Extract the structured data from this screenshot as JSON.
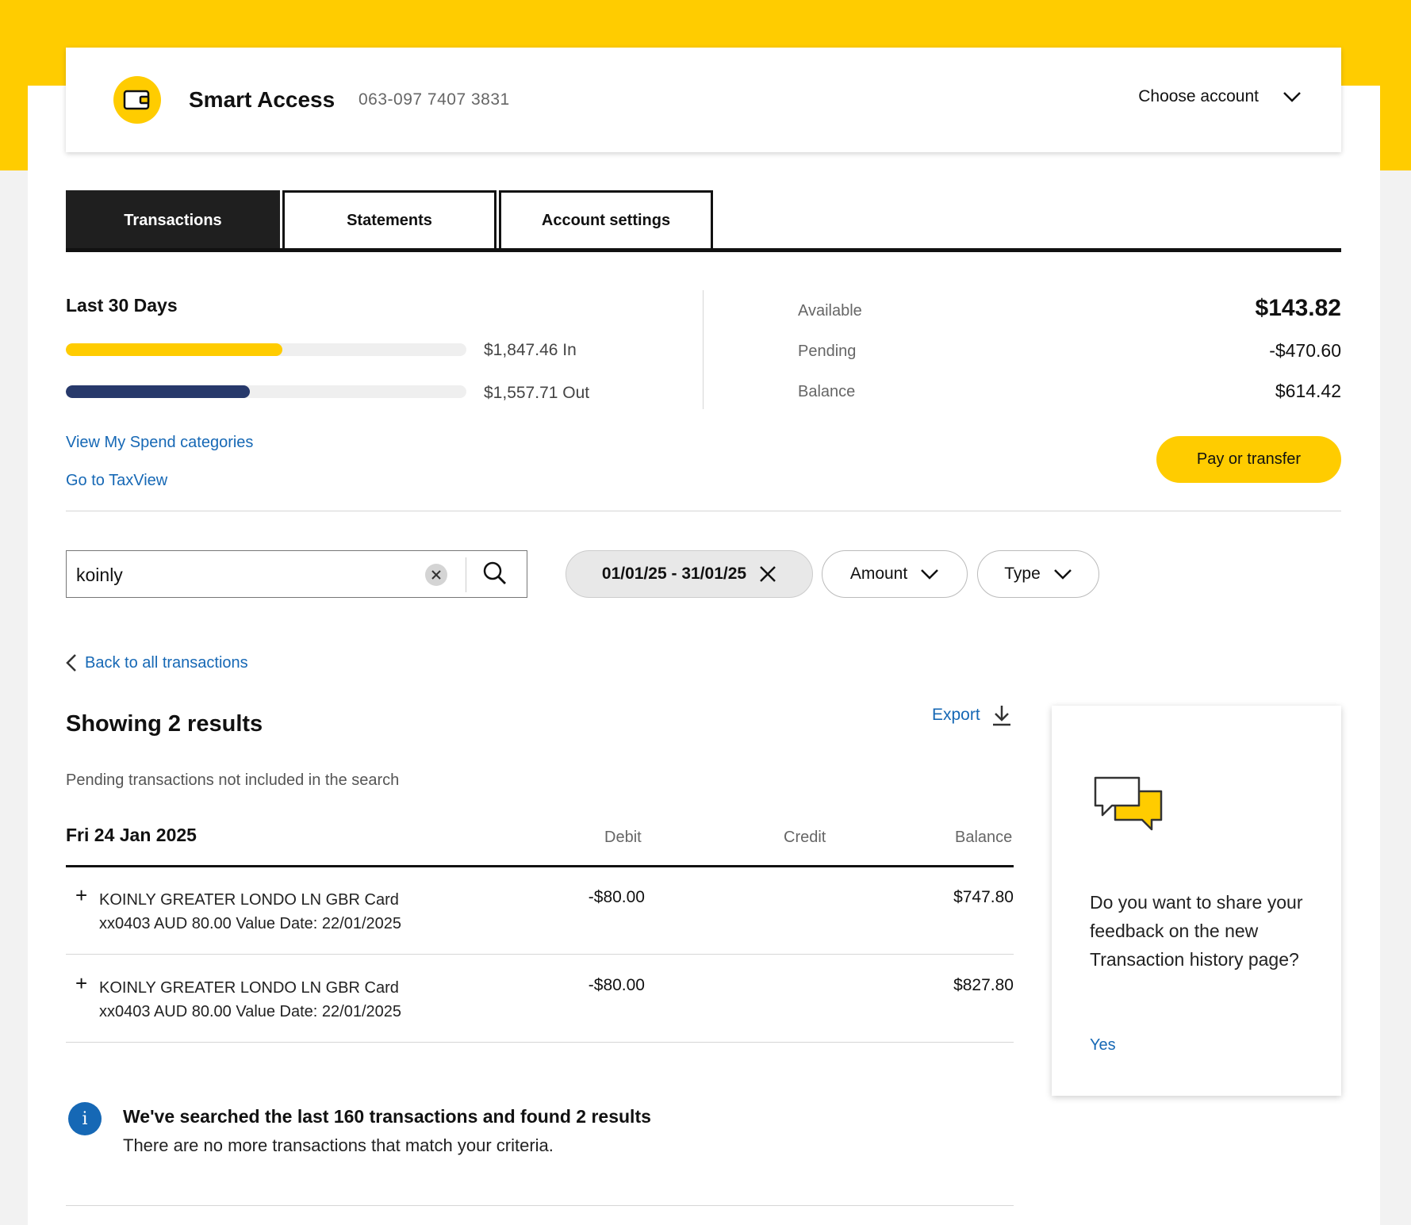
{
  "account": {
    "name": "Smart Access",
    "number": "063-097 7407 3831",
    "choose_label": "Choose account"
  },
  "tabs": [
    {
      "label": "Transactions",
      "active": true
    },
    {
      "label": "Statements",
      "active": false
    },
    {
      "label": "Account settings",
      "active": false
    }
  ],
  "summary": {
    "title": "Last 30 Days",
    "in_label": "$1,847.46 In",
    "out_label": "$1,557.71 Out",
    "in_fraction": 0.54,
    "out_fraction": 0.46,
    "in_color": "#ffcc00",
    "out_color": "#27396b"
  },
  "balances": {
    "available_label": "Available",
    "available_value": "$143.82",
    "pending_label": "Pending",
    "pending_value": "-$470.60",
    "balance_label": "Balance",
    "balance_value": "$614.42"
  },
  "links": {
    "spend_categories": "View My Spend categories",
    "taxview": "Go to TaxView"
  },
  "pay_button": "Pay or transfer",
  "search": {
    "value": "koinly",
    "clear_icon": "clear-icon",
    "search_icon": "search-icon"
  },
  "filters": {
    "date_range": "01/01/25 - 31/01/25",
    "amount": "Amount",
    "type": "Type"
  },
  "results": {
    "back_link": "Back to all transactions",
    "title": "Showing 2 results",
    "export": "Export",
    "pending_note": "Pending transactions not included in the search"
  },
  "table": {
    "date": "Fri 24 Jan 2025",
    "columns": {
      "debit": "Debit",
      "credit": "Credit",
      "balance": "Balance"
    },
    "rows": [
      {
        "line1": "KOINLY GREATER LONDO LN GBR Card",
        "line2": "xx0403 AUD 80.00 Value Date: 22/01/2025",
        "debit": "-$80.00",
        "credit": "",
        "balance": "$747.80"
      },
      {
        "line1": "KOINLY GREATER LONDO LN GBR Card",
        "line2": "xx0403 AUD 80.00 Value Date: 22/01/2025",
        "debit": "-$80.00",
        "credit": "",
        "balance": "$827.80"
      }
    ]
  },
  "info": {
    "title": "We've searched the last 160 transactions and found 2 results",
    "text": "There are no more transactions that match your criteria."
  },
  "feedback": {
    "question": "Do you want to share your feedback on the new Transaction history page?",
    "yes": "Yes"
  },
  "colors": {
    "brand_yellow": "#ffcc00",
    "link_blue": "#1668b5",
    "dark": "#1f1f1f"
  }
}
